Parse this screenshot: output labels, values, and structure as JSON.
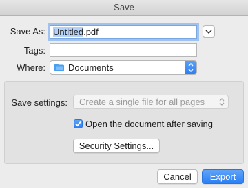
{
  "window": {
    "title": "Save"
  },
  "save_as": {
    "label": "Save As:",
    "value_selected": "Untitled",
    "value_rest": ".pdf"
  },
  "tags": {
    "label": "Tags:",
    "value": ""
  },
  "where": {
    "label": "Where:",
    "value": "Documents"
  },
  "options": {
    "save_settings_label": "Save settings:",
    "save_settings_value": "Create a single file for all pages",
    "open_after_saving_label": "Open the document after saving",
    "open_after_saving_checked": true,
    "security_button_label": "Security Settings..."
  },
  "footer": {
    "cancel_label": "Cancel",
    "export_label": "Export"
  },
  "icons": {
    "expand": "chevron-down-icon",
    "folder": "folder-icon",
    "stepper": "up-down-arrows-icon",
    "dropdown": "up-down-arrows-icon",
    "checkbox": "checkmark-icon"
  },
  "colors": {
    "accent": "#2b7ff6",
    "selection": "#b4d2f8",
    "focus_ring": "#9fc2f0"
  }
}
